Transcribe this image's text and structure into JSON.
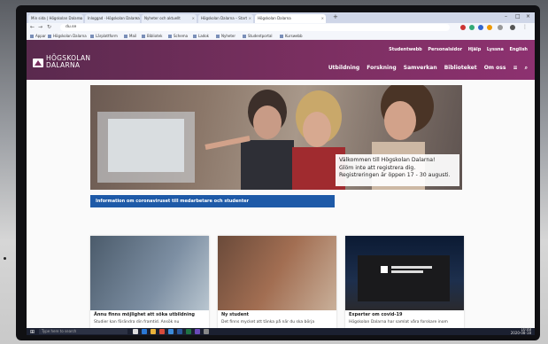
{
  "browser": {
    "tabs": [
      {
        "label": "Min sida | Högskolan Dalarna"
      },
      {
        "label": "Inloggad · Högskolan Dalarna"
      },
      {
        "label": "Nyheter och aktuellt"
      },
      {
        "label": "Högskolan Dalarna – Start"
      },
      {
        "label": "Högskolan Dalarna"
      }
    ],
    "url": "du.se",
    "bookmarks": [
      "Appar",
      "Högskolan Dalarna",
      "Lärplattform",
      "Mail",
      "Bibliotek",
      "Schema",
      "Ladok",
      "Nyheter",
      "Studentportal",
      "Kurswebb"
    ]
  },
  "site": {
    "logo_line1": "HÖGSKOLAN",
    "logo_line2": "DALARNA",
    "utility_nav": [
      "Studentwebb",
      "Personalsidor",
      "Hjälp",
      "Lyssna",
      "English"
    ],
    "main_nav": [
      "Utbildning",
      "Forskning",
      "Samverkan",
      "Biblioteket",
      "Om oss"
    ]
  },
  "hero": {
    "caption_line1": "Välkommen till Högskolan Dalarna!",
    "caption_line2": "Glöm inte att registrera dig.",
    "caption_line3": "Registreringen är öppen 17 - 30 augusti."
  },
  "info_banner": "Information om coronaviruset till medarbetare och studenter",
  "cards": [
    {
      "title": "Ännu finns möjlighet att söka utbildning",
      "text": "Studier kan förändra din framtid. Ansök nu"
    },
    {
      "title": "Ny student",
      "text": "Det finns mycket att tänka på när du ska börja"
    },
    {
      "title": "Experter om covid-19",
      "text": "Högskolan Dalarna har samlat våra forskare inom"
    }
  ],
  "taskbar": {
    "search_placeholder": "Type here to search",
    "time": "10:48",
    "date": "2020-08-18"
  },
  "colors": {
    "header_purple": "#7a2f60",
    "banner_blue": "#1e5aa8",
    "taskbar": "#1b2030"
  }
}
